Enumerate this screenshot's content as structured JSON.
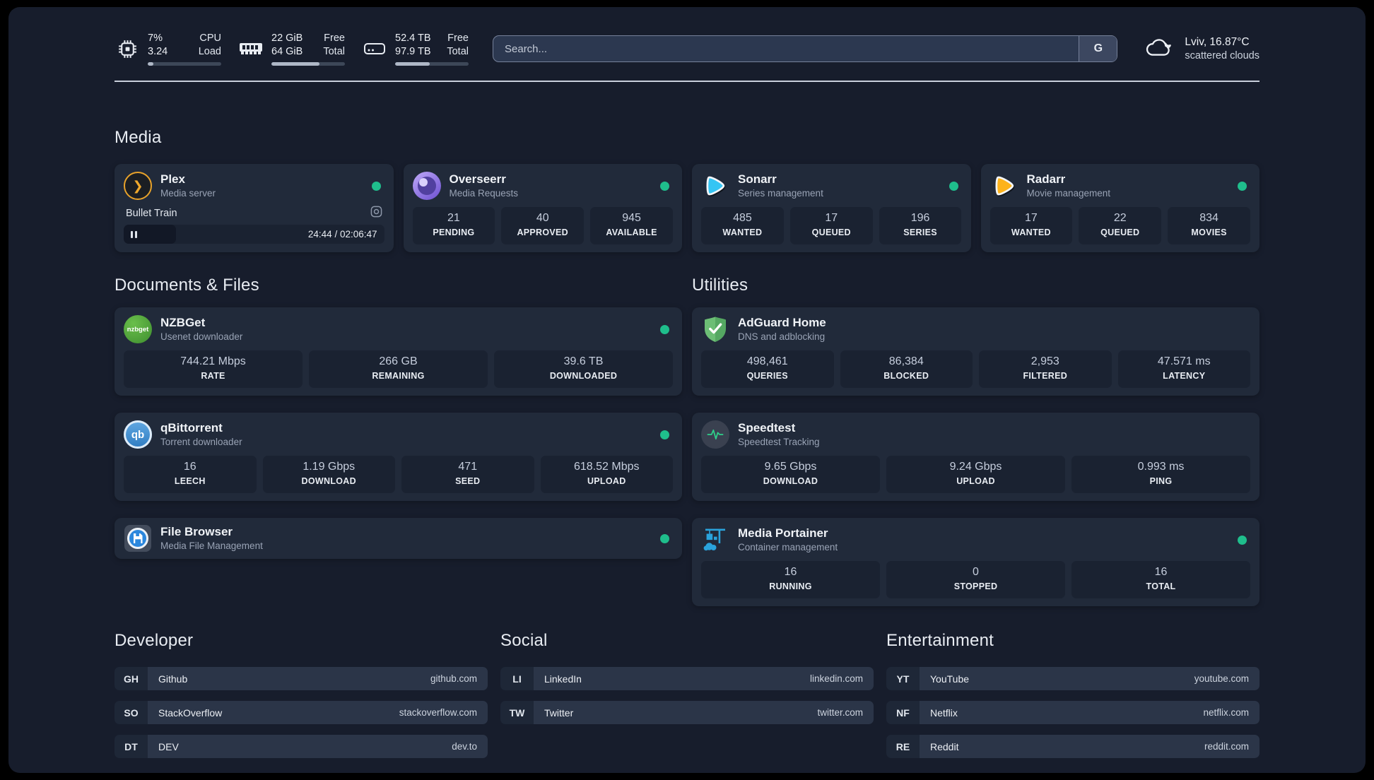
{
  "header": {
    "system_stats": [
      {
        "icon": "cpu",
        "line1": "7%",
        "line2": "3.24",
        "label1": "CPU",
        "label2": "Load",
        "progress": 8
      },
      {
        "icon": "memory",
        "line1": "22 GiB",
        "line2": "64 GiB",
        "label1": "Free",
        "label2": "Total",
        "progress": 65
      },
      {
        "icon": "disk",
        "line1": "52.4 TB",
        "line2": "97.9 TB",
        "label1": "Free",
        "label2": "Total",
        "progress": 47
      }
    ],
    "search": {
      "placeholder": "Search...",
      "provider_button": "G"
    },
    "weather": {
      "location": "Lviv, 16.87°C",
      "condition": "scattered clouds"
    }
  },
  "sections": {
    "media": {
      "title": "Media",
      "plex": {
        "name": "Plex",
        "description": "Media server",
        "now_playing": {
          "title": "Bullet Train",
          "time_display": "24:44 / 02:06:47",
          "progress_percent": 20
        }
      },
      "overseerr": {
        "name": "Overseerr",
        "description": "Media Requests",
        "stats": [
          {
            "value": "21",
            "label": "PENDING"
          },
          {
            "value": "40",
            "label": "APPROVED"
          },
          {
            "value": "945",
            "label": "AVAILABLE"
          }
        ]
      },
      "sonarr": {
        "name": "Sonarr",
        "description": "Series management",
        "stats": [
          {
            "value": "485",
            "label": "WANTED"
          },
          {
            "value": "17",
            "label": "QUEUED"
          },
          {
            "value": "196",
            "label": "SERIES"
          }
        ]
      },
      "radarr": {
        "name": "Radarr",
        "description": "Movie management",
        "stats": [
          {
            "value": "17",
            "label": "WANTED"
          },
          {
            "value": "22",
            "label": "QUEUED"
          },
          {
            "value": "834",
            "label": "MOVIES"
          }
        ]
      }
    },
    "documents": {
      "title": "Documents & Files",
      "nzbget": {
        "name": "NZBGet",
        "description": "Usenet downloader",
        "icon_text": "nzbget",
        "stats": [
          {
            "value": "744.21 Mbps",
            "label": "RATE"
          },
          {
            "value": "266 GB",
            "label": "REMAINING"
          },
          {
            "value": "39.6 TB",
            "label": "DOWNLOADED"
          }
        ]
      },
      "qbittorrent": {
        "name": "qBittorrent",
        "description": "Torrent downloader",
        "icon_text": "qb",
        "stats": [
          {
            "value": "16",
            "label": "LEECH"
          },
          {
            "value": "1.19 Gbps",
            "label": "DOWNLOAD"
          },
          {
            "value": "471",
            "label": "SEED"
          },
          {
            "value": "618.52 Mbps",
            "label": "UPLOAD"
          }
        ]
      },
      "filebrowser": {
        "name": "File Browser",
        "description": "Media File Management"
      }
    },
    "utilities": {
      "title": "Utilities",
      "adguard": {
        "name": "AdGuard Home",
        "description": "DNS and adblocking",
        "stats": [
          {
            "value": "498,461",
            "label": "QUERIES"
          },
          {
            "value": "86,384",
            "label": "BLOCKED"
          },
          {
            "value": "2,953",
            "label": "FILTERED"
          },
          {
            "value": "47.571 ms",
            "label": "LATENCY"
          }
        ]
      },
      "speedtest": {
        "name": "Speedtest",
        "description": "Speedtest Tracking",
        "stats": [
          {
            "value": "9.65 Gbps",
            "label": "DOWNLOAD"
          },
          {
            "value": "9.24 Gbps",
            "label": "UPLOAD"
          },
          {
            "value": "0.993 ms",
            "label": "PING"
          }
        ]
      },
      "portainer": {
        "name": "Media Portainer",
        "description": "Container management",
        "stats": [
          {
            "value": "16",
            "label": "RUNNING"
          },
          {
            "value": "0",
            "label": "STOPPED"
          },
          {
            "value": "16",
            "label": "TOTAL"
          }
        ]
      }
    },
    "links": {
      "developer": {
        "title": "Developer",
        "items": [
          {
            "abbr": "GH",
            "name": "Github",
            "url": "github.com"
          },
          {
            "abbr": "SO",
            "name": "StackOverflow",
            "url": "stackoverflow.com"
          },
          {
            "abbr": "DT",
            "name": "DEV",
            "url": "dev.to"
          }
        ]
      },
      "social": {
        "title": "Social",
        "items": [
          {
            "abbr": "LI",
            "name": "LinkedIn",
            "url": "linkedin.com"
          },
          {
            "abbr": "TW",
            "name": "Twitter",
            "url": "twitter.com"
          }
        ]
      },
      "entertainment": {
        "title": "Entertainment",
        "items": [
          {
            "abbr": "YT",
            "name": "YouTube",
            "url": "youtube.com"
          },
          {
            "abbr": "NF",
            "name": "Netflix",
            "url": "netflix.com"
          },
          {
            "abbr": "RE",
            "name": "Reddit",
            "url": "reddit.com"
          }
        ]
      }
    }
  },
  "colors": {
    "status_online": "#1fbe8c",
    "background": "#171d2c",
    "card": "#212a3a",
    "accent_amber": "#e8a22a",
    "accent_green": "#57a863",
    "accent_blue": "#2aa3dc"
  }
}
